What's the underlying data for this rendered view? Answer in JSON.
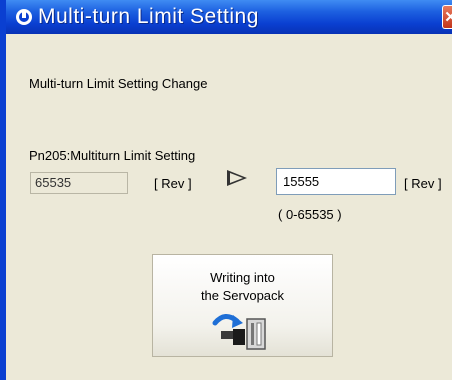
{
  "window": {
    "title": "Multi-turn Limit Setting"
  },
  "dialog": {
    "heading": "Multi-turn Limit Setting Change",
    "param_label": "Pn205:Multiturn Limit Setting",
    "current_value": "65535",
    "current_unit": "[ Rev ]",
    "new_value": "15555",
    "new_unit": "[ Rev ]",
    "range_hint": "( 0-65535 )",
    "write_button_line1": "Writing into",
    "write_button_line2": "the Servopack"
  },
  "icons": {
    "title_icon": "app-icon",
    "close": "close-icon",
    "arrow": "right-arrow-icon",
    "write": "servopack-write-icon"
  },
  "colors": {
    "titlebar": "#0a3fd1",
    "window_bg": "#ece9d8",
    "close_button": "#c2351a"
  }
}
